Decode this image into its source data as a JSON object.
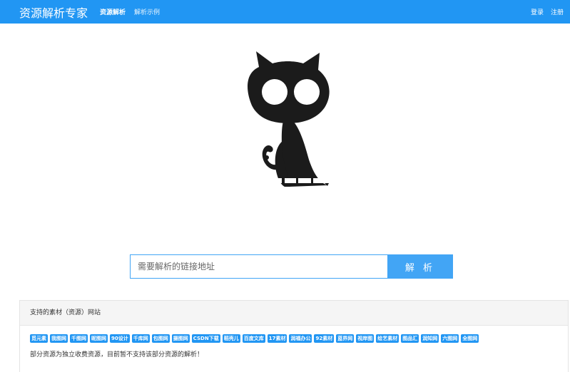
{
  "navbar": {
    "brand": "资源解析专家",
    "links": [
      "资源解析",
      "解析示例"
    ],
    "right": [
      "登录",
      "注册"
    ],
    "color": "#2196f3"
  },
  "search": {
    "placeholder": "需要解析的链接地址",
    "value": "",
    "button_label": "解 析",
    "accent": "#42a5f5"
  },
  "panel": {
    "title": "支持的素材（资源）网站",
    "tags": [
      "觅元素",
      "我图网",
      "千图网",
      "昵图网",
      "90设计",
      "千库网",
      "包图网",
      "摄图网",
      "CSDN下载",
      "稻壳儿",
      "百度文库",
      "17素材",
      "润福办公",
      "92素材",
      "蓝界网",
      "视岸图",
      "绘艺素材",
      "图品汇",
      "润知网",
      "六图网",
      "全图网"
    ],
    "note": "部分资源为独立收费资源，目前暂不支持该部分资源的解析！"
  },
  "logo": {
    "icon": "black-cat-logo"
  }
}
